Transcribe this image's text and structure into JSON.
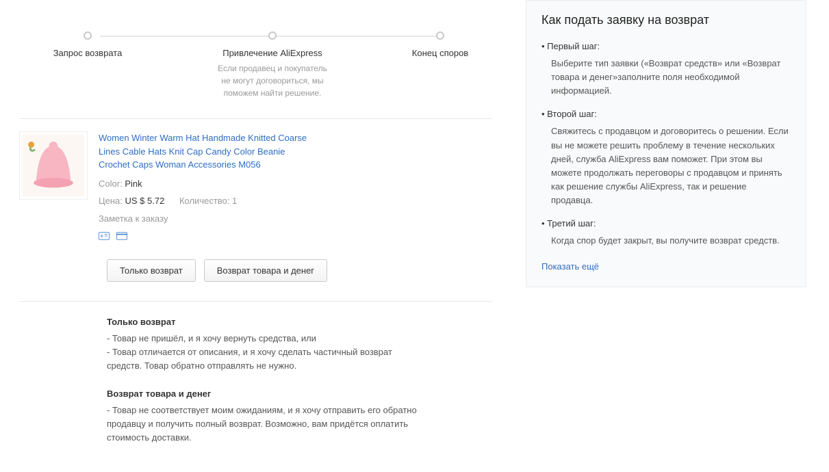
{
  "progress": {
    "step1": {
      "title": "Запрос возврата"
    },
    "step2": {
      "title": "Привлечение AliExpress",
      "desc": "Если продавец и покупатель не могут договориться, мы поможем найти решение."
    },
    "step3": {
      "title": "Конец споров"
    }
  },
  "product": {
    "title": "Women Winter Warm Hat Handmade Knitted Coarse Lines Cable Hats Knit Cap Candy Color Beanie Crochet Caps Woman Accessories M056",
    "color_label": "Color:",
    "color_value": "Pink",
    "price_label": "Цена:",
    "price_value": "US $ 5.72",
    "qty_label": "Количество:",
    "qty_value": "1",
    "note": "Заметка к заказу"
  },
  "buttons": {
    "refund_only": "Только возврат",
    "return_and_money": "Возврат товара и денег"
  },
  "explain": {
    "refund_only_h": "Только возврат",
    "refund_only_l1": "- Товар не пришёл, и я хочу вернуть средства, или",
    "refund_only_l2": "- Товар отличается от описания, и я хочу сделать частичный возврат средств. Товар обратно отправлять не нужно.",
    "return_h": "Возврат товара и денег",
    "return_l1": "- Товар не соответствует моим ожиданиям, и я хочу отправить его обратно продавцу и получить полный возврат. Возможно, вам придётся оплатить стоимость доставки."
  },
  "help": {
    "title": "Как подать заявку на возврат",
    "s1_label": "Первый шаг:",
    "s1_body": "Выберите тип заявки («Возврат средств» или «Возврат товара и денег»заполните поля необходимой информацией.",
    "s2_label": "Второй шаг:",
    "s2_body": "Свяжитесь с продавцом и договоритесь о решении. Если вы не можете решить проблему в течение нескольких дней, служба AliExpress вам поможет. При этом вы можете продолжать переговоры с продавцом и принять как решение службы AliExpress, так и решение продавца.",
    "s3_label": "Третий шаг:",
    "s3_body": "Когда спор будет закрыт, вы получите возврат средств.",
    "more": "Показать ещё"
  }
}
